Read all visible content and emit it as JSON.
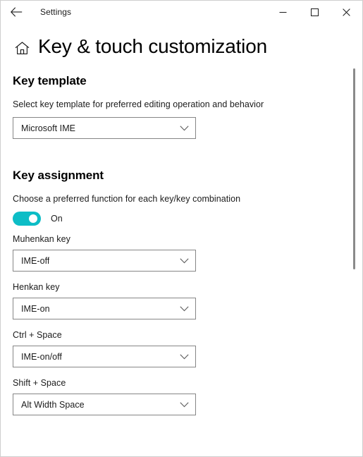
{
  "titlebar": {
    "back_label": "Back",
    "app_title": "Settings",
    "minimize_label": "Minimize",
    "maximize_label": "Maximize",
    "close_label": "Close"
  },
  "page": {
    "home_icon": "home-icon",
    "title": "Key & touch customization"
  },
  "sections": {
    "key_template": {
      "heading": "Key template",
      "description": "Select key template for preferred editing operation and behavior",
      "dropdown": {
        "value": "Microsoft IME",
        "chevron_icon": "chevron-down-icon"
      }
    },
    "key_assignment": {
      "heading": "Key assignment",
      "description": "Choose a preferred function for each key/key combination",
      "toggle": {
        "state_label": "On",
        "checked": true,
        "accent_color": "#0DBDC6"
      },
      "fields": [
        {
          "label": "Muhenkan key",
          "value": "IME-off",
          "chevron_icon": "chevron-down-icon"
        },
        {
          "label": "Henkan key",
          "value": "IME-on",
          "chevron_icon": "chevron-down-icon"
        },
        {
          "label": "Ctrl + Space",
          "value": "IME-on/off",
          "chevron_icon": "chevron-down-icon"
        },
        {
          "label": "Shift + Space",
          "value": "Alt Width Space",
          "chevron_icon": "chevron-down-icon"
        }
      ]
    }
  },
  "scrollbar": {
    "name": "vertical-scrollbar"
  }
}
